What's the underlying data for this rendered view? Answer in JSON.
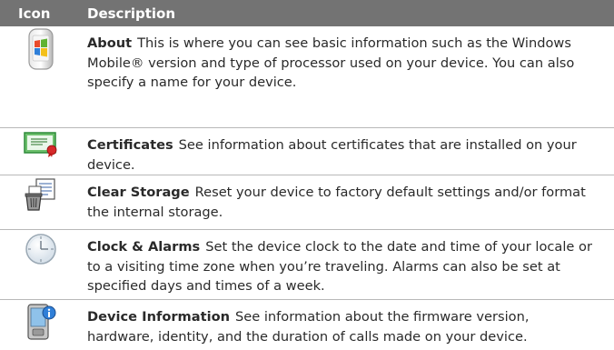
{
  "header": {
    "icon_label": "Icon",
    "description_label": "Description"
  },
  "rows": [
    {
      "icon": "windows-device-icon",
      "title": "About",
      "text": "This is where you can see basic information such as the Windows Mobile® version and type of processor used on your device. You can also specify a name for your device."
    },
    {
      "icon": "certificate-icon",
      "title": "Certificates",
      "text": "See information about certificates that are installed on your device."
    },
    {
      "icon": "clear-storage-icon",
      "title": "Clear Storage",
      "text": "Reset your device to factory default settings and/or format the internal storage."
    },
    {
      "icon": "clock-icon",
      "title": "Clock & Alarms",
      "text": "Set the device clock to the date and time of your locale or to a visiting time zone when you’re traveling. Alarms can also be set at specified days and times of a week."
    },
    {
      "icon": "device-information-icon",
      "title": "Device Information",
      "text": "See information about the firmware version, hardware, identity, and the duration of calls made on your device."
    }
  ]
}
